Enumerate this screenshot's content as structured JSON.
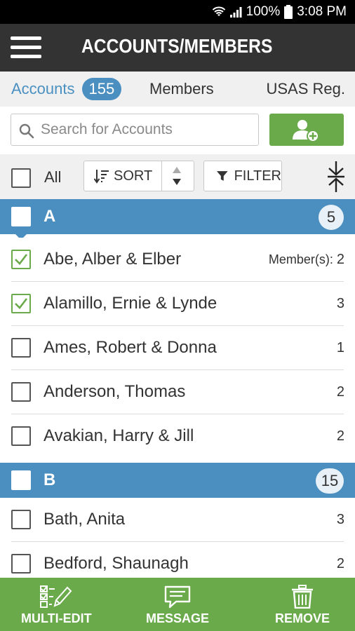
{
  "status": {
    "battery": "100%",
    "time": "3:08 PM"
  },
  "appbar": {
    "title": "ACCOUNTS/MEMBERS"
  },
  "tabs": {
    "accounts": {
      "label": "Accounts",
      "count": "155"
    },
    "members": {
      "label": "Members"
    },
    "usas": {
      "label": "USAS Reg."
    }
  },
  "search": {
    "placeholder": "Search for Accounts",
    "value": ""
  },
  "toolbar": {
    "all_label": "All",
    "sort_label": "SORT",
    "filter_label": "FILTER"
  },
  "sections": [
    {
      "letter": "A",
      "count": "5",
      "rows": [
        {
          "name": "Abe, Alber & Elber",
          "count_prefix": "Member(s): ",
          "count": "2",
          "checked": true
        },
        {
          "name": "Alamillo, Ernie & Lynde",
          "count_prefix": "",
          "count": "3",
          "checked": true
        },
        {
          "name": "Ames, Robert & Donna",
          "count_prefix": "",
          "count": "1",
          "checked": false
        },
        {
          "name": "Anderson, Thomas",
          "count_prefix": "",
          "count": "2",
          "checked": false
        },
        {
          "name": "Avakian, Harry & Jill",
          "count_prefix": "",
          "count": "2",
          "checked": false
        }
      ]
    },
    {
      "letter": "B",
      "count": "15",
      "rows": [
        {
          "name": "Bath, Anita",
          "count_prefix": "",
          "count": "3",
          "checked": false
        },
        {
          "name": "Bedford, Shaunagh",
          "count_prefix": "",
          "count": "2",
          "checked": false
        }
      ]
    }
  ],
  "bottombar": {
    "multi_edit": "MULTI-EDIT",
    "message": "MESSAGE",
    "remove": "REMOVE"
  },
  "colors": {
    "accent_blue": "#4a8fc0",
    "accent_green": "#6aaa4b",
    "appbar": "#333333"
  },
  "icons": {
    "menu": "hamburger-icon",
    "search": "search-icon",
    "add_user": "add-user-icon",
    "sort": "sort-icon",
    "filter": "filter-icon",
    "collapse": "collapse-icon",
    "multi_edit": "multi-edit-icon",
    "message": "message-icon",
    "remove": "trash-icon"
  }
}
